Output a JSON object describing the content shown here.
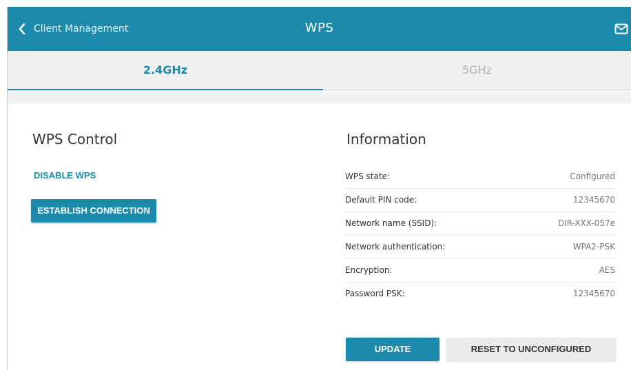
{
  "header": {
    "back_label": "Client Management",
    "title": "WPS",
    "icons": {
      "back": "chevron-left-icon",
      "mail": "mail-icon"
    }
  },
  "tabs": [
    {
      "label": "2.4GHz",
      "active": true
    },
    {
      "label": "5GHz",
      "active": false
    }
  ],
  "wps_control": {
    "title": "WPS Control",
    "disable_label": "DISABLE WPS",
    "establish_label": "ESTABLISH CONNECTION"
  },
  "information": {
    "title": "Information",
    "rows": [
      {
        "label": "WPS state:",
        "value": "Configured"
      },
      {
        "label": "Default PIN code:",
        "value": "12345670"
      },
      {
        "label": "Network name (SSID):",
        "value": "DIR-XXX-057e"
      },
      {
        "label": "Network authentication:",
        "value": "WPA2-PSK"
      },
      {
        "label": "Encryption:",
        "value": "AES"
      },
      {
        "label": "Password PSK:",
        "value": "12345670"
      }
    ],
    "update_label": "UPDATE",
    "reset_label": "RESET TO UNCONFIGURED"
  },
  "colors": {
    "accent": "#1b8aab",
    "inactive_tab": "#b0b0b0",
    "secondary_button": "#ebebeb"
  }
}
